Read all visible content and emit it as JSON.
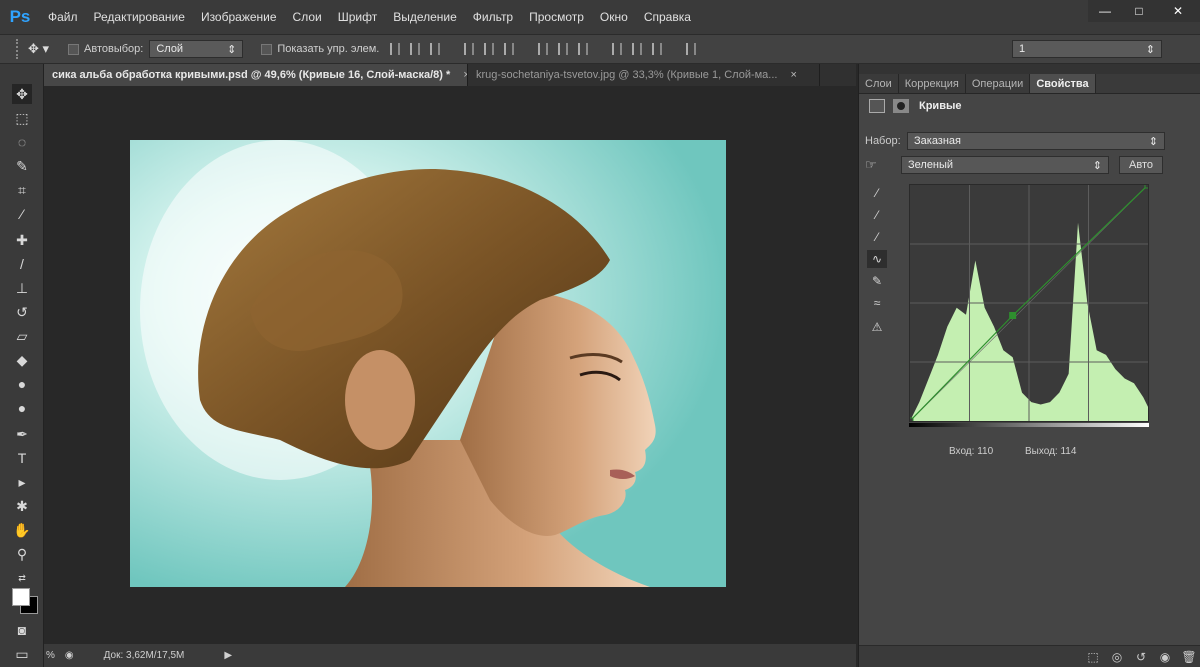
{
  "app": {
    "logo": "Ps"
  },
  "menu": [
    "Файл",
    "Редактирование",
    "Изображение",
    "Слои",
    "Шрифт",
    "Выделение",
    "Фильтр",
    "Просмотр",
    "Окно",
    "Справка"
  ],
  "window_controls": {
    "minimize": "—",
    "maximize": "□",
    "close": "✕"
  },
  "options": {
    "autoselect_label": "Автовыбор:",
    "autoselect_value": "Слой",
    "show_controls_label": "Показать упр. элем.",
    "right_value": "1"
  },
  "tabs": [
    {
      "label": "сика альба обработка кривыми.psd @ 49,6% (Кривые 16, Слой-маска/8) *",
      "active": true
    },
    {
      "label": "krug-sochetaniya-tsvetov.jpg @ 33,3% (Кривые 1, Слой-ма...",
      "active": false
    }
  ],
  "tab_close": "×",
  "status": {
    "zoom": "%",
    "doc": "Док: 3,62M/17,5M"
  },
  "panel_tabs": [
    "Слои",
    "Коррекция",
    "Операции",
    "Свойства"
  ],
  "properties": {
    "title": "Кривые",
    "preset_label": "Набор:",
    "preset_value": "Заказная",
    "channel_value": "Зеленый",
    "auto_label": "Авто",
    "input_label": "Вход:",
    "input_value": "110",
    "output_label": "Выход:",
    "output_value": "114"
  },
  "colors": {
    "histogram_fill": "#c4efb1",
    "curve_line": "#2e8f2e",
    "accent": "#2fa3ff"
  },
  "chart_data": {
    "type": "area",
    "channel": "Зеленый",
    "xlim": [
      0,
      255
    ],
    "ylim": [
      0,
      100
    ],
    "histogram": {
      "x": [
        0,
        10,
        20,
        30,
        40,
        50,
        60,
        70,
        80,
        90,
        100,
        110,
        120,
        130,
        140,
        150,
        160,
        170,
        180,
        190,
        200,
        210,
        220,
        230,
        240,
        250,
        255
      ],
      "y": [
        0,
        8,
        18,
        28,
        40,
        48,
        45,
        68,
        48,
        40,
        30,
        27,
        12,
        8,
        7,
        8,
        12,
        20,
        84,
        50,
        30,
        28,
        22,
        18,
        16,
        10,
        6
      ]
    },
    "curve": {
      "x": [
        0,
        110,
        255
      ],
      "y": [
        0,
        114,
        255
      ]
    }
  }
}
